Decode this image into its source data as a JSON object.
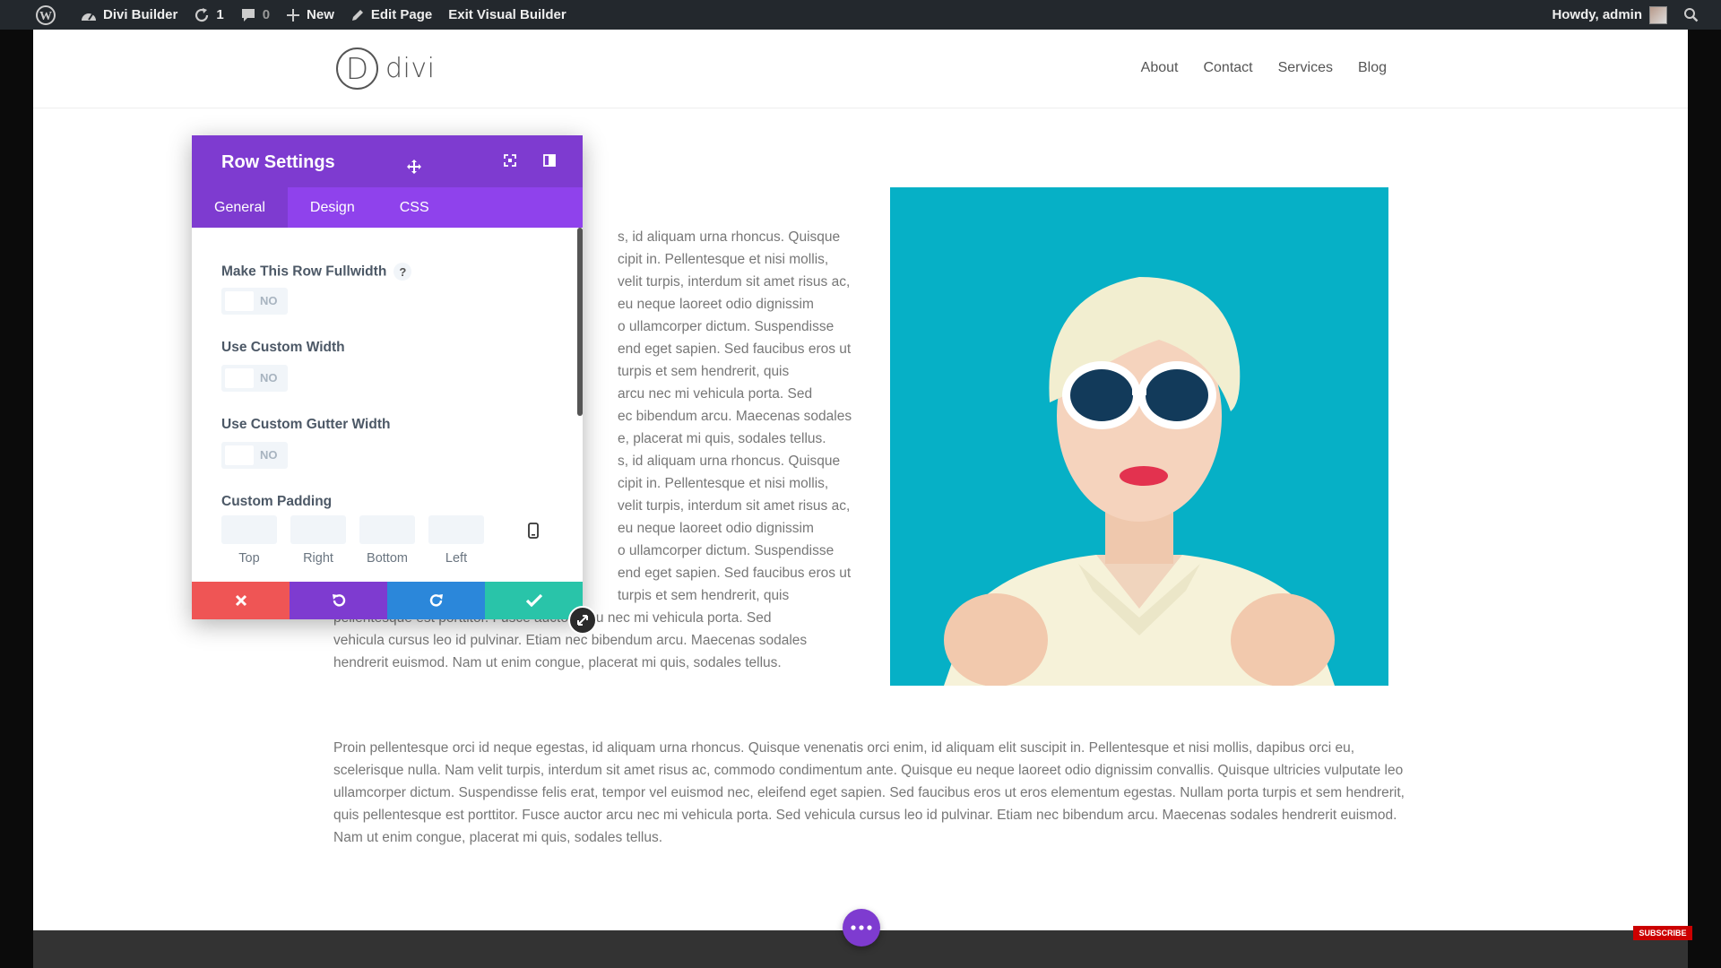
{
  "admin_bar": {
    "site_name": "Divi Builder",
    "updates_count": "1",
    "comments_count": "0",
    "new_label": "New",
    "edit_page_label": "Edit Page",
    "exit_builder_label": "Exit Visual Builder",
    "howdy_label": "Howdy, admin"
  },
  "site": {
    "logo_letter": "D",
    "logo_text": "divi",
    "nav": [
      "About",
      "Contact",
      "Services",
      "Blog"
    ]
  },
  "content": {
    "column_lines": [
      "s, id aliquam urna rhoncus. Quisque",
      "cipit in. Pellentesque et nisi mollis,",
      "velit turpis, interdum sit amet risus ac,",
      "eu neque laoreet odio dignissim",
      "o ullamcorper dictum. Suspendisse",
      "end eget sapien. Sed faucibus eros ut",
      "turpis et sem hendrerit, quis",
      "arcu nec mi vehicula porta. Sed",
      "ec bibendum arcu. Maecenas sodales",
      "e, placerat mi quis, sodales tellus.",
      "s, id aliquam urna rhoncus. Quisque",
      "cipit in. Pellentesque et nisi mollis,",
      "velit turpis, interdum sit amet risus ac,",
      "eu neque laoreet odio dignissim",
      "o ullamcorper dictum. Suspendisse",
      "end eget sapien. Sed faucibus eros ut",
      "turpis et sem hendrerit, quis",
      "pellentesque est porttitor. Fusce auctor arcu nec mi vehicula porta. Sed",
      "vehicula cursus leo id pulvinar. Etiam nec bibendum arcu. Maecenas sodales",
      "hendrerit euismod. Nam ut enim congue, placerat mi quis, sodales tellus."
    ],
    "full_width_paragraph": "Proin pellentesque orci id neque egestas, id aliquam urna rhoncus. Quisque venenatis orci enim, id aliquam elit suscipit in. Pellentesque et nisi mollis, dapibus orci eu, scelerisque nulla. Nam velit turpis, interdum sit amet risus ac, commodo condimentum ante. Quisque eu neque laoreet odio dignissim convallis. Quisque ultricies vulputate leo ullamcorper dictum. Suspendisse felis erat, tempor vel euismod nec, eleifend eget sapien. Sed faucibus eros ut eros elementum egestas. Nullam porta turpis et sem hendrerit, quis pellentesque est porttitor. Fusce auctor arcu nec mi vehicula porta. Sed vehicula cursus leo id pulvinar. Etiam nec bibendum arcu. Maecenas sodales hendrerit euismod. Nam ut enim congue, placerat mi quis, sodales tellus."
  },
  "modal": {
    "title": "Row Settings",
    "tabs": [
      "General",
      "Design",
      "CSS"
    ],
    "active_tab": "General",
    "fields": {
      "fullwidth_label": "Make This Row Fullwidth",
      "help_glyph": "?",
      "fullwidth_value": "NO",
      "custom_width_label": "Use Custom Width",
      "custom_width_value": "NO",
      "gutter_label": "Use Custom Gutter Width",
      "gutter_value": "NO",
      "padding_label": "Custom Padding",
      "padding_sides": [
        "Top",
        "Right",
        "Bottom",
        "Left"
      ]
    }
  },
  "colors": {
    "divi_purple": "#7e3bd0",
    "tab_purple": "#8f42ec",
    "cancel_red": "#ef5555",
    "undo_purple": "#7e3bd0",
    "redo_blue": "#2b87da",
    "save_green": "#29c4a9",
    "hero_bg": "#06aac0"
  },
  "overlay": {
    "subscribe_label": "SUBSCRIBE"
  }
}
